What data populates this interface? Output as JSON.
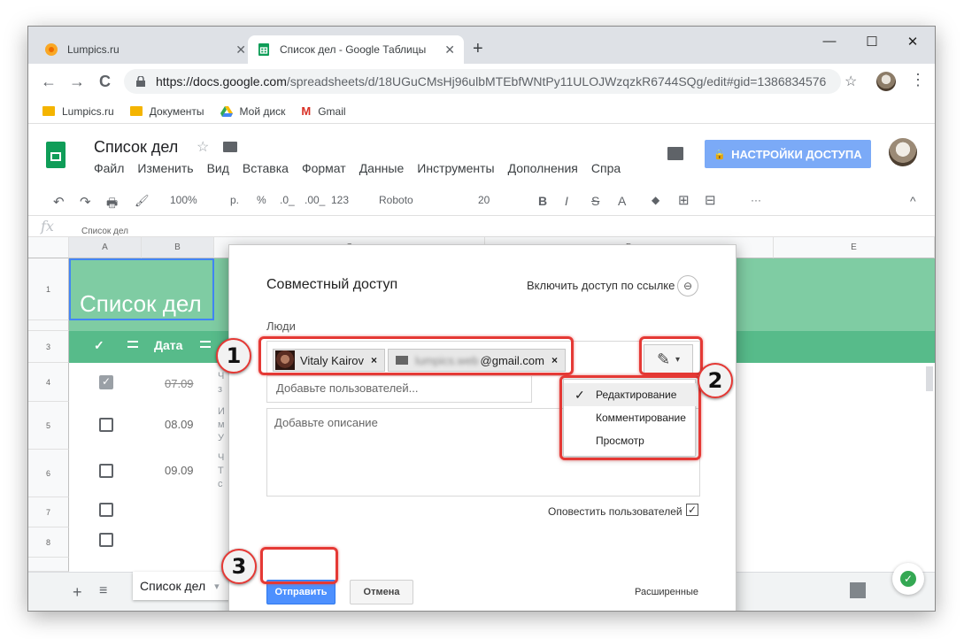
{
  "browser": {
    "tabs": [
      {
        "title": "Lumpics.ru",
        "favicon": "orange-circle-icon",
        "active": false
      },
      {
        "title": "Список дел - Google Таблицы",
        "favicon": "sheets-icon",
        "active": true
      }
    ],
    "new_tab": "+",
    "window_controls": {
      "minimize": "—",
      "maximize": "☐",
      "close": "✕"
    },
    "nav": {
      "back": "←",
      "forward": "→",
      "reload": "C"
    },
    "url_host": "https://docs.google.com",
    "url_path": "/spreadsheets/d/18UGuCMsHj96ulbMTEbfWNtPy11ULOJWzqzkR6744SQg/edit#gid=1386834576",
    "bookmark_star": "☆",
    "menu_dots": "⋮",
    "bookmarks": [
      {
        "label": "Lumpics.ru",
        "icon": "folder-icon"
      },
      {
        "label": "Документы",
        "icon": "folder-icon"
      },
      {
        "label": "Мой диск",
        "icon": "drive-icon"
      },
      {
        "label": "Gmail",
        "icon": "gmail-icon"
      }
    ]
  },
  "sheets": {
    "title": "Список дел",
    "star": "☆",
    "menu": [
      "Файл",
      "Изменить",
      "Вид",
      "Вставка",
      "Формат",
      "Данные",
      "Инструменты",
      "Дополнения",
      "Спра"
    ],
    "share_button": "НАСТРОЙКИ ДОСТУПА",
    "share_lock": "🔒",
    "toolbar": {
      "undo": "↶",
      "redo": "↷",
      "print": "🖶",
      "paint": "🖌",
      "zoom": "100%",
      "currency": "р.",
      "percent": "%",
      "dec_less": ".0_",
      "dec_more": ".00_",
      "more_formats": "123",
      "font": "Roboto",
      "font_size": "20",
      "bold": "B",
      "italic": "I",
      "strike": "S",
      "text_color": "A",
      "fill": "◆",
      "borders": "⊞",
      "merge": "⊟",
      "more": "···",
      "collapse": "^"
    },
    "formula_label": "fx",
    "formula_value": "Список дел",
    "columns": [
      "A",
      "B",
      "C",
      "D",
      "E"
    ],
    "rows": [
      "1",
      "3",
      "4",
      "5",
      "6",
      "7",
      "8"
    ],
    "sheet_title_cell": "Список дел",
    "header_check": "✓",
    "header_date": "Дата",
    "tasks": [
      {
        "checked": true,
        "date": "07.09",
        "struck": true,
        "text": "Ч\nз"
      },
      {
        "checked": false,
        "date": "08.09",
        "struck": false,
        "text": "И\nм\nУ"
      },
      {
        "checked": false,
        "date": "09.09",
        "struck": false,
        "text": "Ч\nТ\nс"
      },
      {
        "checked": false,
        "date": "",
        "struck": false,
        "text": ""
      },
      {
        "checked": false,
        "date": "",
        "struck": false,
        "text": ""
      }
    ],
    "bottom": {
      "add": "+",
      "list": "≡",
      "sheet_tab": "Список дел",
      "sheet_tab_arrow": "▾"
    }
  },
  "dialog": {
    "title": "Совместный доступ",
    "link_sharing": "Включить доступ по ссылке",
    "link_icon": "🔗",
    "people_label": "Люди",
    "chips": [
      {
        "name": "Vitaly Kairov",
        "x": "×"
      },
      {
        "email_hidden": "lumpics.web",
        "email_visible": "@gmail.com",
        "x": "×"
      }
    ],
    "permission_icon": "✎",
    "permission_caret": "▾",
    "add_users_placeholder": "Добавьте пользователей...",
    "description_placeholder": "Добавьте описание",
    "notify_label": "Оповестить пользователей",
    "notify_checked": "✓",
    "send": "Отправить",
    "cancel": "Отмена",
    "advanced": "Расширенные",
    "permissions": [
      {
        "label": "Редактирование",
        "selected": true
      },
      {
        "label": "Комментирование",
        "selected": false
      },
      {
        "label": "Просмотр",
        "selected": false
      }
    ],
    "selected_mark": "✓"
  },
  "callouts": [
    "1",
    "2",
    "3"
  ],
  "colors": {
    "accent": "#e53935",
    "share": "#7baaf7",
    "send": "#4d90fe",
    "band": "#7fcca3",
    "band_dark": "#57bb8a"
  }
}
